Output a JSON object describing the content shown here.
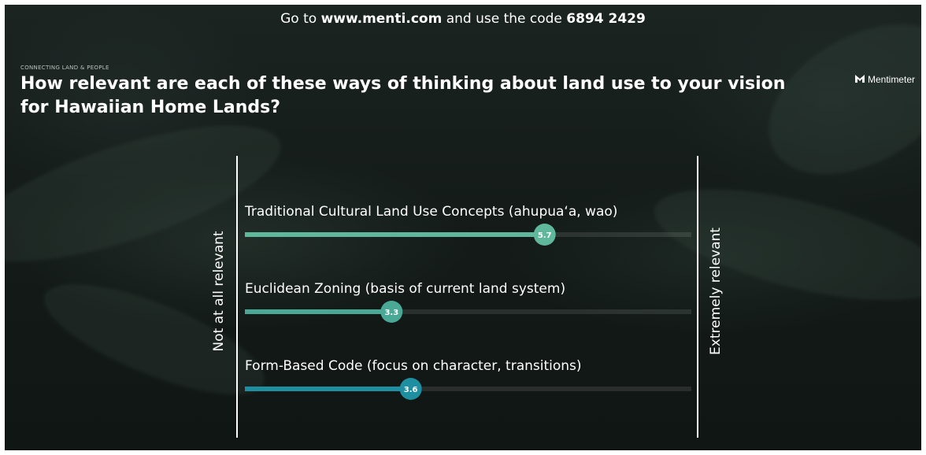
{
  "join": {
    "prefix": "Go to ",
    "url": "www.menti.com",
    "middle": " and use the code ",
    "code": "6894 2429"
  },
  "eyebrow": "CONNECTING LAND & PEOPLE",
  "title": "How relevant are each of these ways of thinking about land use to your vision for Hawaiian Home Lands?",
  "brand": {
    "name": "Mentimeter",
    "icon": "mentimeter-logo-icon"
  },
  "chart_data": {
    "type": "bar",
    "orientation": "horizontal",
    "categories": [
      "Traditional Cultural Land Use Concepts (ahupua‘a, wao)",
      "Euclidean Zoning (basis of current land system)",
      "Form-Based Code (focus on character, transitions)"
    ],
    "values": [
      5.7,
      3.3,
      3.6
    ],
    "value_labels": [
      "5.7",
      "3.3",
      "3.6"
    ],
    "xlim": [
      1,
      8
    ],
    "min_label": "Not at all relevant",
    "max_label": "Extremely relevant",
    "colors": [
      "#5fb89c",
      "#4aa896",
      "#1e8fa0"
    ]
  }
}
